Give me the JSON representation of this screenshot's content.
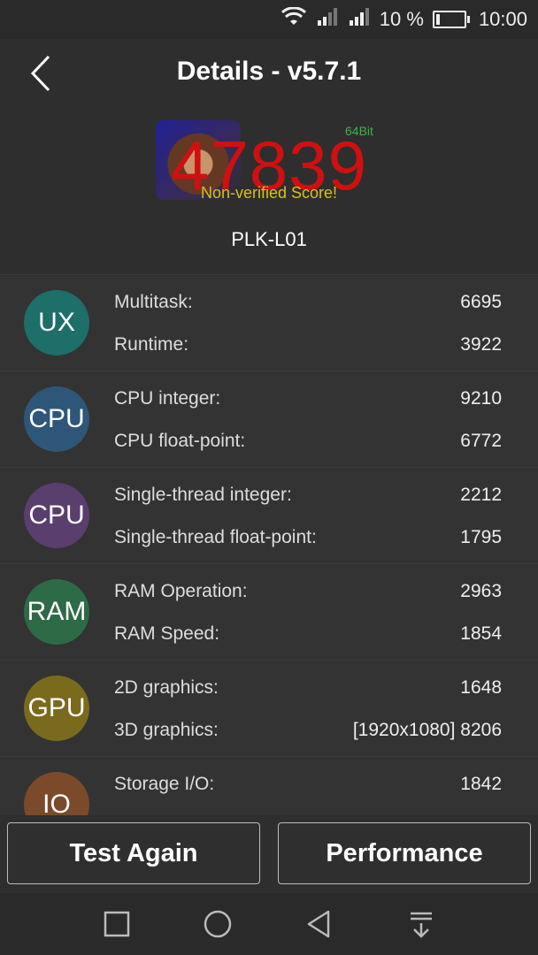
{
  "status_bar": {
    "battery_text": "10 %",
    "time": "10:00",
    "icons": [
      "wifi-icon",
      "signal-icon",
      "signal-icon",
      "battery-icon"
    ]
  },
  "header": {
    "title": "Details - v5.7.1",
    "back_icon": "back-chevron-icon"
  },
  "score": {
    "value": "47839",
    "bit_label": "64Bit",
    "note": "Non-verified Score!",
    "device": "PLK-L01",
    "colors": {
      "score": "#d01010",
      "bit": "#3cb44b",
      "note": "#d8c020"
    }
  },
  "categories": [
    {
      "icon_label": "UX",
      "icon_color": "#1e6e6a",
      "rows": [
        {
          "label": "Multitask:",
          "value": "6695"
        },
        {
          "label": "Runtime:",
          "value": "3922"
        }
      ]
    },
    {
      "icon_label": "CPU",
      "icon_color": "#2e5678",
      "rows": [
        {
          "label": "CPU integer:",
          "value": "9210"
        },
        {
          "label": "CPU float-point:",
          "value": "6772"
        }
      ]
    },
    {
      "icon_label": "CPU",
      "icon_color": "#5a3e6e",
      "rows": [
        {
          "label": "Single-thread integer:",
          "value": "2212"
        },
        {
          "label": "Single-thread float-point:",
          "value": "1795"
        }
      ]
    },
    {
      "icon_label": "RAM",
      "icon_color": "#2f6a47",
      "rows": [
        {
          "label": "RAM Operation:",
          "value": "2963"
        },
        {
          "label": "RAM Speed:",
          "value": "1854"
        }
      ]
    },
    {
      "icon_label": "GPU",
      "icon_color": "#7a6a1e",
      "rows": [
        {
          "label": "2D graphics:",
          "value": "1648"
        },
        {
          "label": "3D graphics:",
          "value": "[1920x1080] 8206"
        }
      ]
    },
    {
      "icon_label": "IO",
      "icon_color": "#7a4a2a",
      "rows": [
        {
          "label": "Storage I/O:",
          "value": "1842"
        }
      ]
    }
  ],
  "actions": {
    "test_again": "Test Again",
    "performance": "Performance"
  },
  "navbar": {
    "icons": [
      "recent-apps-icon",
      "home-icon",
      "back-triangle-icon",
      "notification-pull-icon"
    ]
  }
}
